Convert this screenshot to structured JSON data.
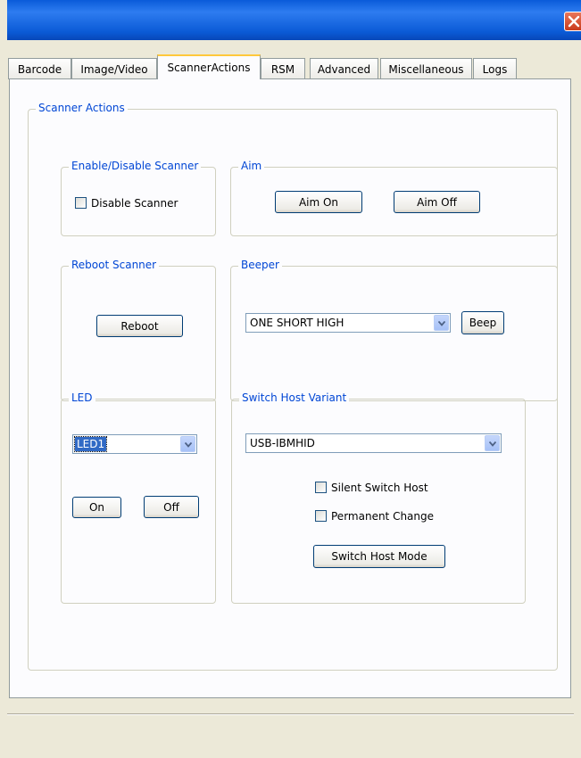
{
  "window": {
    "title": "",
    "close_icon": "close-x-icon",
    "close_color": "#d6461f",
    "titlebar_color": "#0a5ad6"
  },
  "tabs": [
    {
      "label": "Barcode"
    },
    {
      "label": "Image/Video"
    },
    {
      "label": "ScannerActions",
      "active": true
    },
    {
      "label": "RSM"
    },
    {
      "label": "Advanced"
    },
    {
      "label": "Miscellaneous"
    },
    {
      "label": "Logs"
    }
  ],
  "scanner_actions": {
    "title": "Scanner Actions",
    "enable_disable": {
      "title": "Enable/Disable Scanner",
      "disable_label": "Disable Scanner",
      "disable_checked": false
    },
    "aim": {
      "title": "Aim",
      "aim_on_label": "Aim On",
      "aim_off_label": "Aim Off"
    },
    "reboot": {
      "title": "Reboot Scanner",
      "reboot_label": "Reboot"
    },
    "beeper": {
      "title": "Beeper",
      "selected_tone": "ONE SHORT HIGH",
      "beep_label": "Beep"
    },
    "led": {
      "title": "LED",
      "selected_led": "LED1",
      "on_label": "On",
      "off_label": "Off"
    },
    "switch_host": {
      "title": "Switch Host Variant",
      "selected_variant": "USB-IBMHID",
      "silent_label": "Silent Switch Host",
      "silent_checked": false,
      "permanent_label": "Permanent Change",
      "permanent_checked": false,
      "switch_mode_label": "Switch Host Mode"
    }
  },
  "colors": {
    "group_title": "#0046d5",
    "window_bg": "#ece9d8",
    "panel_bg": "#fcfcfe",
    "active_tab_accent": "#ffc83c"
  }
}
